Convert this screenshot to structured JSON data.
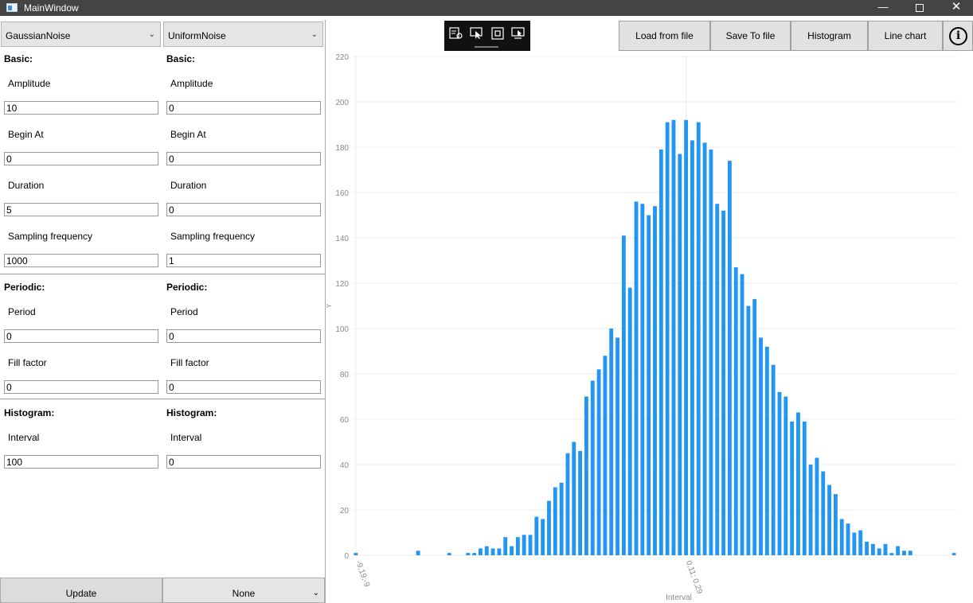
{
  "window": {
    "title": "MainWindow",
    "controls": {
      "minimize": "—",
      "close": "✕"
    },
    "icons": {
      "app": "window-app-icon",
      "minimize": "minimize-icon",
      "maximize": "maximize-icon",
      "close": "close-icon"
    }
  },
  "left": {
    "signal1": {
      "type": "GaussianNoise",
      "basic_header": "Basic:",
      "amplitude_label": "Amplitude",
      "amplitude": "10",
      "begin_label": "Begin At",
      "begin": "0",
      "duration_label": "Duration",
      "duration": "5",
      "sampling_label": "Sampling frequency",
      "sampling": "1000",
      "periodic_header": "Periodic:",
      "period_label": "Period",
      "period": "0",
      "fill_label": "Fill factor",
      "fill": "0",
      "histogram_header": "Histogram:",
      "interval_label": "Interval",
      "interval": "100"
    },
    "signal2": {
      "type": "UniformNoise",
      "basic_header": "Basic:",
      "amplitude_label": "Amplitude",
      "amplitude": "0",
      "begin_label": "Begin At",
      "begin": "0",
      "duration_label": "Duration",
      "duration": "0",
      "sampling_label": "Sampling frequency",
      "sampling": "1",
      "periodic_header": "Periodic:",
      "period_label": "Period",
      "period": "0",
      "fill_label": "Fill factor",
      "fill": "0",
      "histogram_header": "Histogram:",
      "interval_label": "Interval",
      "interval": "0"
    },
    "update_label": "Update",
    "operation": "None"
  },
  "toolbar": {
    "load_label": "Load from file",
    "save_label": "Save To file",
    "histogram_label": "Histogram",
    "linechart_label": "Line chart",
    "info_label": "i",
    "tools": [
      "chart-settings-icon",
      "select-pointer-icon",
      "fit-zoom-icon",
      "screen-select-icon"
    ]
  },
  "chart_data": {
    "type": "bar",
    "xlabel": "Interval",
    "ylabel": "Y",
    "ylim": [
      0,
      220
    ],
    "yticks": [
      0,
      20,
      40,
      60,
      80,
      100,
      120,
      140,
      160,
      180,
      200,
      220
    ],
    "visible_category_labels": [
      {
        "index": 0,
        "label": "-9,19;-9"
      },
      {
        "index": 53,
        "label": "0,11; 0,29"
      }
    ],
    "grid": true,
    "color": "#2196F3",
    "values": [
      1,
      0,
      0,
      0,
      0,
      0,
      0,
      0,
      0,
      0,
      2,
      0,
      0,
      0,
      0,
      1,
      0,
      0,
      1,
      1,
      3,
      4,
      3,
      3,
      8,
      4,
      8,
      9,
      9,
      17,
      16,
      24,
      30,
      32,
      45,
      50,
      46,
      70,
      77,
      82,
      88,
      100,
      96,
      141,
      118,
      156,
      155,
      150,
      154,
      179,
      191,
      192,
      177,
      192,
      183,
      191,
      182,
      179,
      155,
      152,
      174,
      127,
      124,
      110,
      113,
      96,
      92,
      84,
      72,
      70,
      59,
      63,
      59,
      40,
      43,
      37,
      31,
      27,
      16,
      14,
      10,
      11,
      6,
      5,
      3,
      5,
      1,
      4,
      2,
      2,
      0,
      0,
      0,
      0,
      0,
      0,
      1
    ]
  }
}
